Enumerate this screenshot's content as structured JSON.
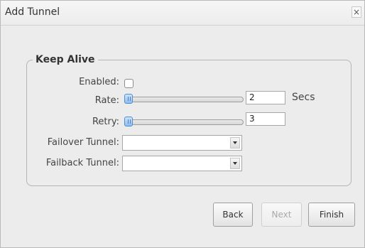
{
  "dialog": {
    "title": "Add Tunnel",
    "close_label": "×"
  },
  "keep_alive": {
    "legend": "Keep Alive",
    "enabled_label": "Enabled:",
    "enabled_checked": false,
    "rate_label": "Rate:",
    "rate_value": "2",
    "rate_unit": "Secs",
    "retry_label": "Retry:",
    "retry_value": "3",
    "failover_label": "Failover Tunnel:",
    "failover_value": "",
    "failback_label": "Failback Tunnel:",
    "failback_value": ""
  },
  "buttons": {
    "back": "Back",
    "next": "Next",
    "finish": "Finish"
  }
}
